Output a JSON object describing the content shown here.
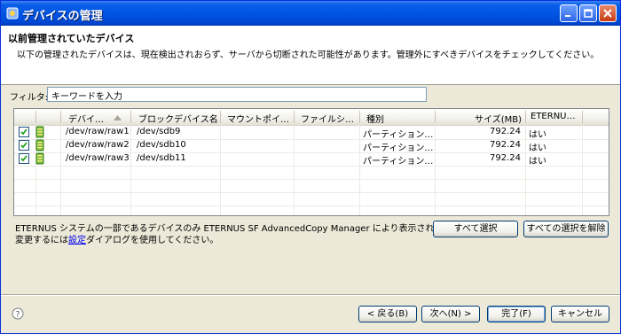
{
  "window": {
    "title": "デバイスの管理"
  },
  "banner": {
    "heading": "以前管理されていたデバイス",
    "description": "以下の管理されたデバイスは、現在検出されおらず、サーバから切断された可能性があります。管理外にすべきデバイスをチェックしてください。"
  },
  "filter": {
    "label": "フィルタ:",
    "value": "キーワードを入力"
  },
  "table": {
    "columns": [
      "デバイ…",
      "ブロックデバイス名",
      "マウントポイ…",
      "ファイルシ…",
      "種別",
      "サイズ(MB)",
      "ETERNU…"
    ],
    "rows": [
      {
        "checked": true,
        "device": "/dev/raw/raw1",
        "block": "/dev/sdb9",
        "mount": "",
        "fs": "",
        "type": "パーティション…",
        "size": "792.24",
        "eternus": "はい"
      },
      {
        "checked": true,
        "device": "/dev/raw/raw2",
        "block": "/dev/sdb10",
        "mount": "",
        "fs": "",
        "type": "パーティション…",
        "size": "792.24",
        "eternus": "はい"
      },
      {
        "checked": true,
        "device": "/dev/raw/raw3",
        "block": "/dev/sdb11",
        "mount": "",
        "fs": "",
        "type": "パーティション…",
        "size": "792.24",
        "eternus": "はい"
      }
    ]
  },
  "info": {
    "line1": "ETERNUS システムの一部であるデバイスのみ ETERNUS SF AdvancedCopy Manager により表示されています。",
    "line2_prefix": "変更するには",
    "line2_link": "設定",
    "line2_suffix": "ダイアログを使用してください。"
  },
  "buttons": {
    "select_all": "すべて選択",
    "deselect_all": "すべての選択を解除",
    "back": "< 戻る(B)",
    "next": "次へ(N) >",
    "finish": "完了(F)",
    "cancel": "キャンセル"
  },
  "icons": [
    "app-icon",
    "minimize-icon",
    "maximize-icon",
    "close-icon",
    "sort-ascending-icon",
    "checkbox-icon",
    "disk-device-icon",
    "help-icon"
  ],
  "colors": {
    "titlebar": "#0054e3",
    "dialog_bg": "#ece9d8",
    "link": "#0000ee"
  }
}
